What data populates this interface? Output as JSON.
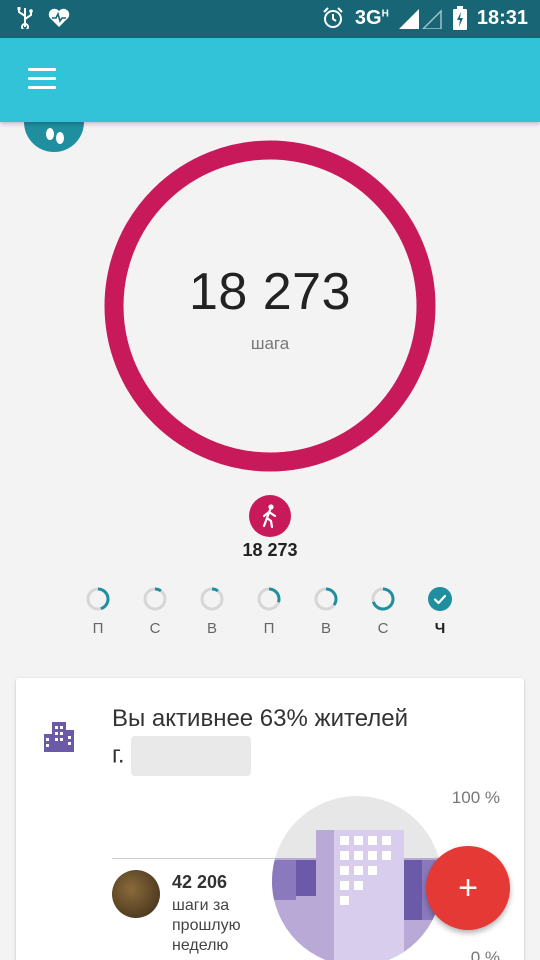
{
  "status_bar": {
    "network": "3G",
    "network_sup": "H",
    "time": "18:31",
    "icons": [
      "usb-icon",
      "heart-icon",
      "alarm-icon",
      "signal-icon",
      "battery-icon"
    ]
  },
  "app_bar": {
    "menu_icon": "hamburger-menu-icon",
    "color": "#33c3d9"
  },
  "steps": {
    "value": "18 273",
    "label": "шага",
    "ring_color": "#c81a5a",
    "walk_icon": "walking-person-icon",
    "walk_count": "18 273"
  },
  "week": {
    "days": [
      {
        "label": "П",
        "progress": 0.45,
        "today": false
      },
      {
        "label": "С",
        "progress": 0.1,
        "today": false
      },
      {
        "label": "В",
        "progress": 0.1,
        "today": false
      },
      {
        "label": "П",
        "progress": 0.3,
        "today": false
      },
      {
        "label": "В",
        "progress": 0.35,
        "today": false
      },
      {
        "label": "С",
        "progress": 0.7,
        "today": false
      },
      {
        "label": "Ч",
        "progress": 1.0,
        "today": true
      }
    ],
    "accent": "#1f8fa0"
  },
  "card": {
    "title_line1": "Вы активнее 63% жителей",
    "title_line2": "г.",
    "pct_top": "100 %",
    "pct_bottom": "0 %",
    "user_steps": "42 206",
    "user_sub": "шаги за прошлую неделю",
    "icon": "city-building-icon",
    "icon_color": "#6b5aa8"
  },
  "fab": {
    "icon": "plus-icon",
    "label": "+",
    "color": "#e53935"
  }
}
